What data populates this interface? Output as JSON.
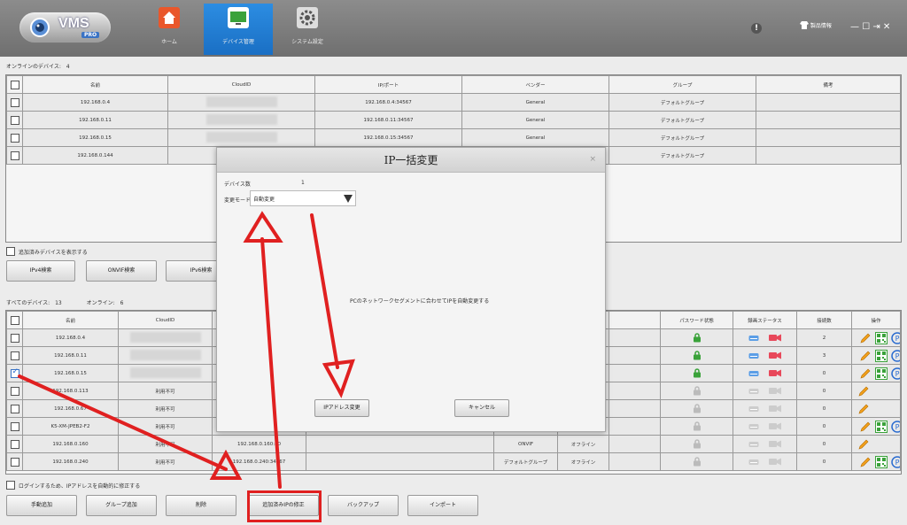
{
  "header": {
    "logo_text": "VMS",
    "logo_badge": "PRO",
    "nav": [
      {
        "label": "ホーム",
        "icon": "home-icon"
      },
      {
        "label": "デバイス管理",
        "icon": "device-icon"
      },
      {
        "label": "システム設定",
        "icon": "gear-icon"
      }
    ],
    "product_info": "製品情報",
    "info_glyph": "!"
  },
  "online_section": {
    "label": "オンラインのデバイス:",
    "count": "4",
    "columns": [
      "名前",
      "CloudID",
      "IP/ポート",
      "ベンダー",
      "グループ",
      "備考"
    ],
    "rows": [
      {
        "name": "192.168.0.4",
        "ip": "192.168.0.4:34567",
        "vendor": "General",
        "group": "デフォルトグループ"
      },
      {
        "name": "192.168.0.11",
        "ip": "192.168.0.11:34567",
        "vendor": "General",
        "group": "デフォルトグループ"
      },
      {
        "name": "192.168.0.15",
        "ip": "192.168.0.15:34567",
        "vendor": "General",
        "group": "デフォルトグループ"
      },
      {
        "name": "192.168.0.144",
        "ip": "",
        "vendor": "",
        "group": "デフォルトグループ"
      }
    ],
    "show_added": "追加済みデバイスを表示する",
    "search_buttons": [
      "IPv4検索",
      "ONVIF検索",
      "IPv6検索"
    ]
  },
  "all_section": {
    "label": "すべてのデバイス:",
    "count": "13",
    "online_label": "オンライン:",
    "online_count": "6",
    "columns": [
      "名前",
      "CloudID",
      "パスワード状態",
      "録画ステータス",
      "接続数",
      "操作"
    ],
    "rows": [
      {
        "name": "192.168.0.4",
        "cloud": "",
        "ip": "",
        "vendor": "",
        "status": "",
        "connections": "2",
        "checked": false,
        "active": true
      },
      {
        "name": "192.168.0.11",
        "cloud": "",
        "ip": "",
        "vendor": "",
        "status": "",
        "connections": "3",
        "checked": false,
        "active": true
      },
      {
        "name": "192.168.0.15",
        "cloud": "",
        "ip": "",
        "vendor": "",
        "status": "",
        "connections": "0",
        "checked": true,
        "active": true
      },
      {
        "name": "192.168.0.113",
        "cloud": "利用不可",
        "ip": "",
        "vendor": "",
        "status": "",
        "connections": "0",
        "checked": false,
        "active": false
      },
      {
        "name": "192.168.0.67",
        "cloud": "利用不可",
        "ip": "",
        "vendor": "",
        "status": "",
        "connections": "0",
        "checked": false,
        "active": false
      },
      {
        "name": "K5-XM-JPEB2-F2",
        "cloud": "利用不可",
        "ip": "",
        "vendor": "",
        "status": "",
        "connections": "0",
        "checked": false,
        "active": false
      },
      {
        "name": "192.168.0.160",
        "cloud": "利用不可",
        "ip": "192.168.0.160:80",
        "vendor": "ONVIF",
        "status": "オフライン",
        "connections": "0",
        "checked": false,
        "active": false
      },
      {
        "name": "192.168.0.240",
        "cloud": "利用不可",
        "ip": "192.168.0.240:34567",
        "vendor": "デフォルトグループ",
        "status": "オフライン",
        "connections": "0",
        "checked": false,
        "active": false
      }
    ],
    "auto_fix": "ログインするため、IPアドレスを自動的に修正する",
    "bottom_buttons": [
      "手動追加",
      "グループ追加",
      "削除",
      "追加済みIPの修正",
      "バックアップ",
      "インポート"
    ]
  },
  "dialog": {
    "title": "IP一括変更",
    "close": "×",
    "device_count_label": "デバイス数",
    "device_count": "1",
    "mode_label": "変更モード",
    "mode_value": "自動変更",
    "description": "PCのネットワークセグメントに合わせてIPを自動変更する",
    "ok_button": "IPアドレス変更",
    "cancel_button": "キャンセル"
  },
  "colors": {
    "accent": "#1a6fc4",
    "annotation": "#e02020",
    "offline": "#dd0000"
  }
}
